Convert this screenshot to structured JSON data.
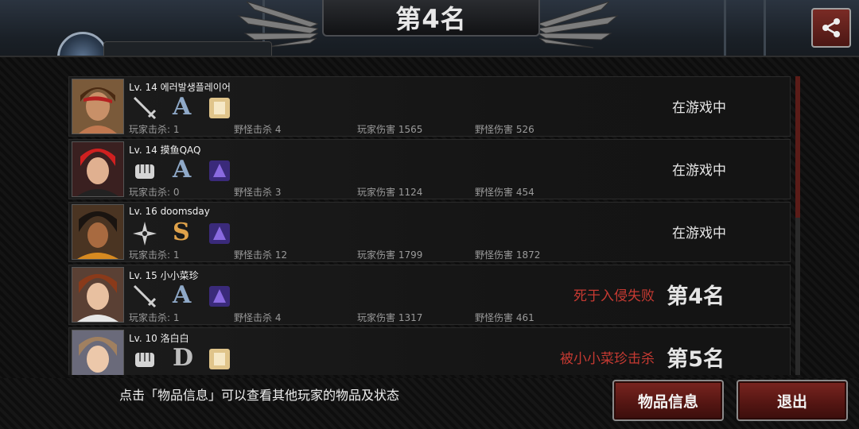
{
  "header": {
    "title": "第4名"
  },
  "hint_text": "点击「物品信息」可以查看其他玩家的物品及状态",
  "buttons": {
    "items": "物品信息",
    "exit": "退出"
  },
  "players": [
    {
      "level_name": "Lv. 14 에러발생플레이어",
      "weapon": "sword-icon",
      "grade": "A",
      "item": "scroll-item-icon",
      "player_kills": "玩家击杀: 1",
      "monster_kills": "野怪击杀 4",
      "player_damage": "玩家伤害 1565",
      "monster_damage": "野怪伤害 526",
      "status": "在游戏中"
    },
    {
      "level_name": "Lv. 14 摸鱼QAQ",
      "weapon": "fist-icon",
      "grade": "A",
      "item": "purple-item-icon",
      "player_kills": "玩家击杀: 0",
      "monster_kills": "野怪击杀 3",
      "player_damage": "玩家伤害 1124",
      "monster_damage": "野怪伤害 454",
      "status": "在游戏中"
    },
    {
      "level_name": "Lv. 16 doomsday",
      "weapon": "shuriken-icon",
      "grade": "S",
      "item": "purple-item-icon",
      "player_kills": "玩家击杀: 1",
      "monster_kills": "野怪击杀 12",
      "player_damage": "玩家伤害 1799",
      "monster_damage": "野怪伤害 1872",
      "status": "在游戏中"
    },
    {
      "level_name": "Lv. 15 小小菜珍",
      "weapon": "sword-icon",
      "grade": "A",
      "item": "purple-item-icon",
      "player_kills": "玩家击杀: 1",
      "monster_kills": "野怪击杀 4",
      "player_damage": "玩家伤害 1317",
      "monster_damage": "野怪伤害 461",
      "death": "死于入侵失败",
      "rank": "第4名"
    },
    {
      "level_name": "Lv. 10 洛白白",
      "weapon": "fist-icon",
      "grade": "D",
      "item": "scroll-item-icon",
      "death": "被小小菜珍击杀",
      "rank": "第5名"
    }
  ],
  "colors": {
    "grade_A": "#8fa9c8",
    "grade_S": "#e0a24a",
    "grade_D": "#bdbdbd",
    "death": "#c63a32",
    "button": "#7a2520"
  }
}
